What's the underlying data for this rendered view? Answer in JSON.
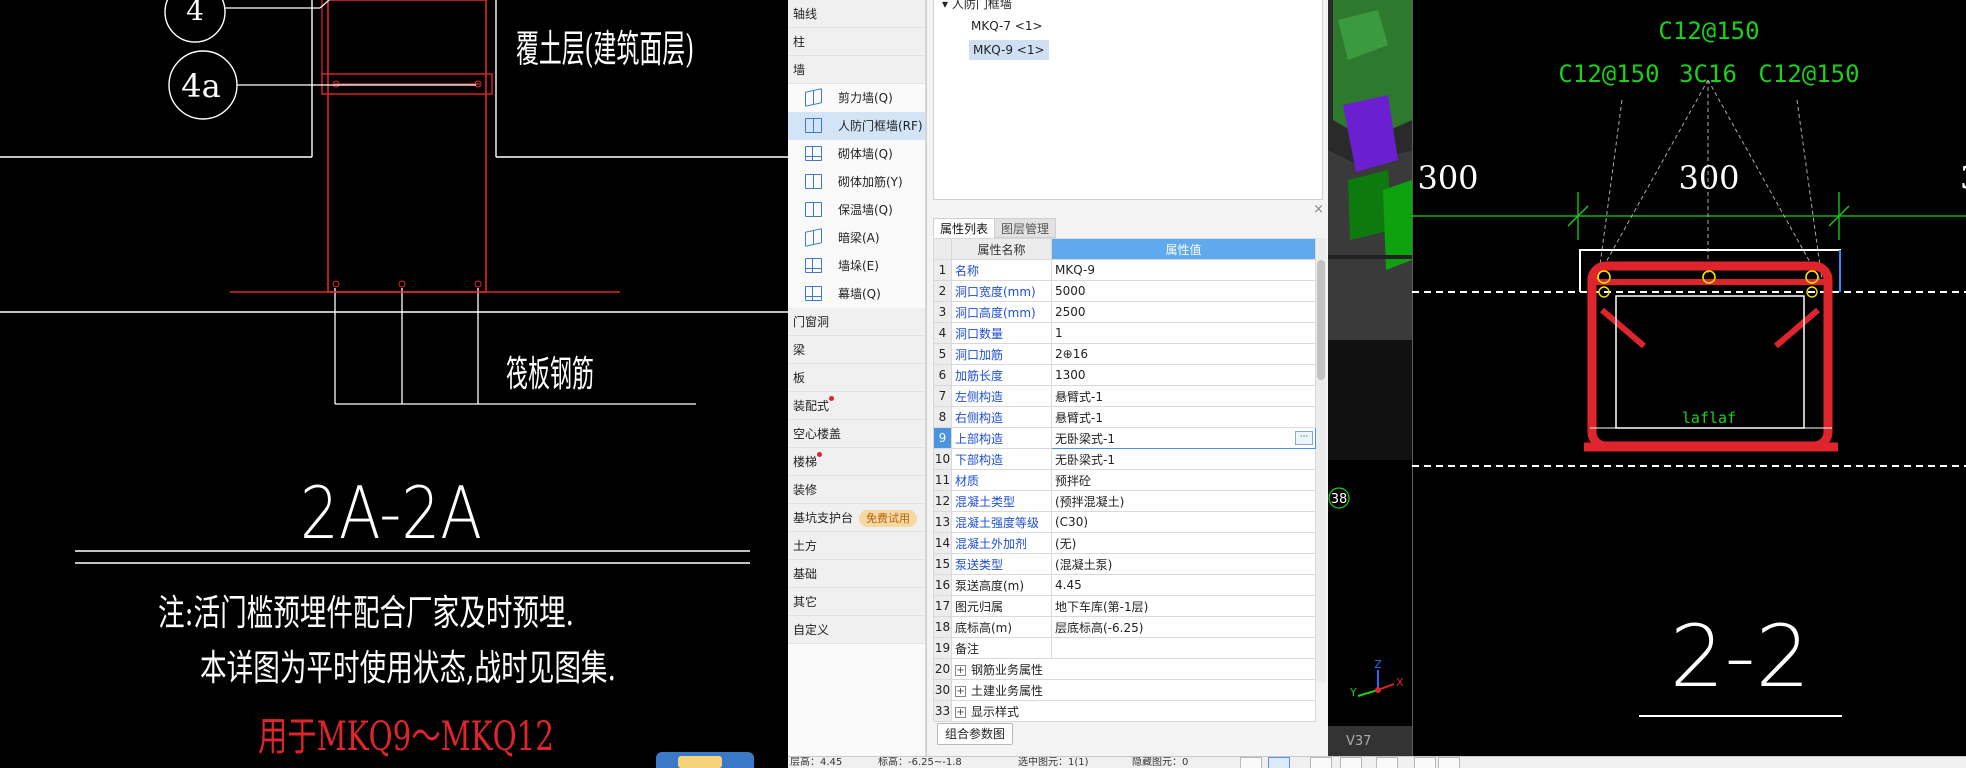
{
  "left_drawing": {
    "tag_top": "4",
    "tag_mid": "4a",
    "note_cover": "覆土层(建筑面层)",
    "note_raft": "筏板钢筋",
    "section_title": "2A-2A",
    "note_line1": "注:活门槛预埋件配合厂家及时预埋.",
    "note_line2": "本详图为平时使用状态,战时见图集.",
    "note_applies": "用于MKQ9～MKQ12"
  },
  "nav": {
    "items": [
      {
        "label": "轴线"
      },
      {
        "label": "柱"
      },
      {
        "label": "墙"
      },
      {
        "label": "剪力墙(Q)"
      },
      {
        "label": "人防门框墙(RF)"
      },
      {
        "label": "砌体墙(Q)"
      },
      {
        "label": "砌体加筋(Y)"
      },
      {
        "label": "保温墙(Q)"
      },
      {
        "label": "暗梁(A)"
      },
      {
        "label": "墙垛(E)"
      },
      {
        "label": "幕墙(Q)"
      },
      {
        "label": "门窗洞"
      },
      {
        "label": "梁"
      },
      {
        "label": "板"
      },
      {
        "label": "装配式"
      },
      {
        "label": "空心楼盖"
      },
      {
        "label": "楼梯"
      },
      {
        "label": "装修"
      },
      {
        "label": "基坑支护台"
      },
      {
        "label": "土方"
      },
      {
        "label": "基础"
      },
      {
        "label": "其它"
      },
      {
        "label": "自定义"
      }
    ],
    "trial_badge": "免费试用"
  },
  "tree": {
    "root": "人防门框墙",
    "items": [
      {
        "label": "MKQ-7 <1>"
      },
      {
        "label": "MKQ-9 <1>"
      }
    ]
  },
  "props": {
    "tabs": [
      "属性列表",
      "图层管理"
    ],
    "headers": {
      "name": "属性名称",
      "value": "属性值"
    },
    "rows": [
      {
        "n": "1",
        "name": "名称",
        "value": "MKQ-9"
      },
      {
        "n": "2",
        "name": "洞口宽度(mm)",
        "value": "5000"
      },
      {
        "n": "3",
        "name": "洞口高度(mm)",
        "value": "2500"
      },
      {
        "n": "4",
        "name": "洞口数量",
        "value": "1"
      },
      {
        "n": "5",
        "name": "洞口加筋",
        "value": "2⊕16"
      },
      {
        "n": "6",
        "name": "加筋长度",
        "value": "1300"
      },
      {
        "n": "7",
        "name": "左侧构造",
        "value": "悬臂式-1"
      },
      {
        "n": "8",
        "name": "右侧构造",
        "value": "悬臂式-1"
      },
      {
        "n": "9",
        "name": "上部构造",
        "value": "无卧梁式-1"
      },
      {
        "n": "10",
        "name": "下部构造",
        "value": "无卧梁式-1"
      },
      {
        "n": "11",
        "name": "材质",
        "value": "预拌砼"
      },
      {
        "n": "12",
        "name": "混凝土类型",
        "value": "(预拌混凝土)"
      },
      {
        "n": "13",
        "name": "混凝土强度等级",
        "value": "(C30)"
      },
      {
        "n": "14",
        "name": "混凝土外加剂",
        "value": "(无)"
      },
      {
        "n": "15",
        "name": "泵送类型",
        "value": "(混凝土泵)"
      },
      {
        "n": "16",
        "name": "泵送高度(m)",
        "value": "4.45"
      },
      {
        "n": "17",
        "name": "图元归属",
        "value": "地下车库(第-1层)"
      },
      {
        "n": "18",
        "name": "底标高(m)",
        "value": "层底标高(-6.25)"
      },
      {
        "n": "19",
        "name": "备注",
        "value": ""
      },
      {
        "n": "20",
        "name": "钢筋业务属性",
        "value": ""
      },
      {
        "n": "30",
        "name": "土建业务属性",
        "value": ""
      },
      {
        "n": "33",
        "name": "显示样式",
        "value": ""
      }
    ],
    "ellipsis": "···",
    "plus": "+",
    "combo_button": "组合参数图",
    "close": "×"
  },
  "view3d": {
    "marker": "38",
    "axis_z": "Z",
    "axis_y": "Y",
    "axis_x": "X",
    "version": "V37"
  },
  "right_drawing": {
    "rebar_top": "C12@150",
    "rebar_left": "C12@150",
    "rebar_center": "3C16",
    "rebar_right": "C12@150",
    "dim_left": "300",
    "dim_center": "300",
    "dim_right": "3",
    "anchor_label": "laflaf",
    "section_title": "2-2"
  },
  "status_bar": {
    "floor_height": "层高：4.45",
    "elevation": "标高：-6.25~-1.8",
    "selected": "选中图元：1(1)",
    "hidden": "隐藏图元：0"
  },
  "colors": {
    "accent": "#4b93dd",
    "cad_red": "#e0242c",
    "cad_green": "#19d119",
    "link_blue": "#1f4fd6"
  }
}
